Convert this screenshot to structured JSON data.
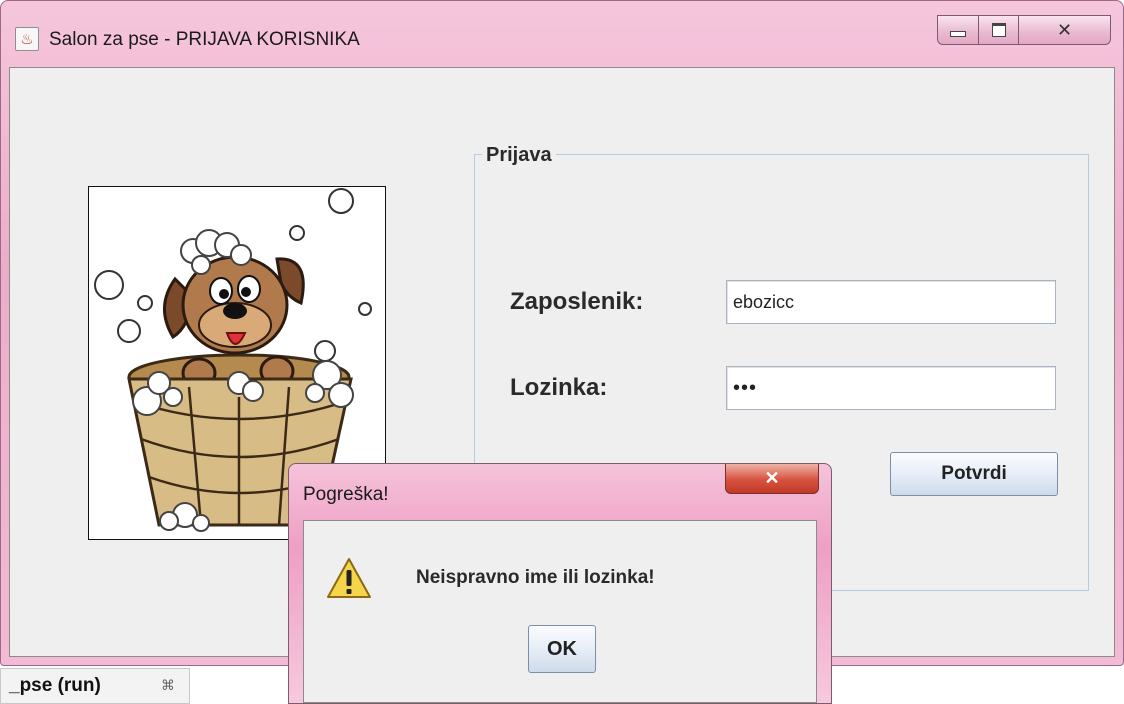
{
  "window": {
    "title": "Salon za pse - PRIJAVA KORISNIKA",
    "icon": "java-icon",
    "buttons": [
      "minimize-icon",
      "maximize-icon",
      "close-icon"
    ]
  },
  "form": {
    "legend": "Prijava",
    "fields": [
      {
        "label": "Zaposlenik:",
        "value": "ebozicc"
      },
      {
        "label": "Lozinka:",
        "value": "•••"
      }
    ],
    "submit_label": "Potvrdi"
  },
  "picture": {
    "subject": "dog-in-bathtub"
  },
  "dialog": {
    "title": "Pogreška!",
    "message": "Neispravno ime ili lozinka!",
    "ok_label": "OK",
    "icon": "warning-icon"
  },
  "taskbar_tab": {
    "label": "_pse (run)",
    "close_glyph": "⌘"
  },
  "colors": {
    "title_bar": "#eeaccb",
    "dialog_close": "#c23a28",
    "panel": "#efefef"
  }
}
